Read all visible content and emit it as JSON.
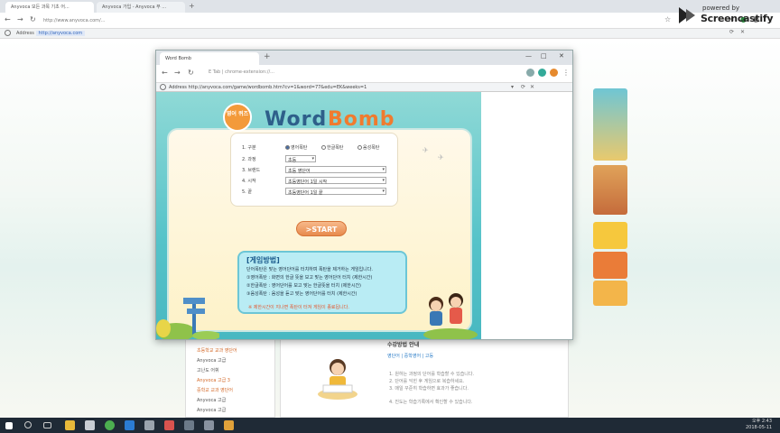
{
  "outer_browser": {
    "tabs": [
      {
        "label": "Anyvoca 모든 과목 기초 어..."
      },
      {
        "label": "Anyvoca 가입 - Anyvoca 무 ..."
      }
    ],
    "url": "http://www.anyvoca.com/...",
    "address_label": "Address",
    "address_url": "http://anyvoca.com"
  },
  "screencastify": {
    "powered": "powered by",
    "name": "Screencastify"
  },
  "popup": {
    "tab_title": "Word Bomb",
    "url": "E Tab | chrome-extension://...",
    "address_label": "Address",
    "address_url": "http://anyvoca.com/game/wordbomb.htm?cv=1&word=77&edu=EK&weeks=1"
  },
  "game": {
    "badge": "영어 퀴즈",
    "title_word": "Word",
    "title_bomb": "Bomb",
    "form": {
      "row1_label": "1. 구분",
      "row1_options": [
        {
          "label": "영어폭탄",
          "checked": true
        },
        {
          "label": "한글폭탄",
          "checked": false
        },
        {
          "label": "음성폭탄",
          "checked": false
        }
      ],
      "row2_label": "2. 과정",
      "row2_value": "초등",
      "row3_label": "3. 브랜드",
      "row3_value": "초등 영단어",
      "row4_label": "4. 시작",
      "row4_value": "초등영단어 1일 시작",
      "row5_label": "5. 끝",
      "row5_value": "초등영단어 1일 끝"
    },
    "start_label": ">START",
    "howto": {
      "title": "[게임방법]",
      "lines": [
        "단어폭탄은 맞는 영어단어를 터치하며 폭탄을 제거하는 게임입니다.",
        "①영어폭탄 : 화면의 한글 뜻을 보고 맞는 영어단어 터치 (제한시간)",
        "②한글폭탄 : 영어단어를 보고 맞는 한글뜻을 터치 (제한시간)",
        "③음성폭탄 : 음성을 듣고 맞는 영어단어를 터치 (제한시간)"
      ],
      "warning": "※ 제한시간이 지나면 폭탄이 터져 게임이 종료됩니다."
    }
  },
  "background_page": {
    "sidebar_links": [
      {
        "label": "초등학교 교과 영단어",
        "orange": true
      },
      {
        "label": "Anyvoca 고급",
        "orange": false
      },
      {
        "label": "고난도 어휘",
        "orange": false
      },
      {
        "label": "Anyvoca 고급 3",
        "orange": true
      },
      {
        "label": "중학교 교과 영단어",
        "orange": true
      },
      {
        "label": "Anyvoca 고급",
        "orange": false
      },
      {
        "label": "Anyvoca 고급",
        "orange": false
      }
    ],
    "notice_title": "수강방법 안내",
    "notice_tabs": "영단어 | 중학영어 | 고등",
    "notice_lines": [
      "1. 원하는 과정의 단어를 학습할 수 있습니다.",
      "2. 단어를 익힌 후 게임으로 복습하세요.",
      "3. 매일 꾸준히 학습하면 효과가 좋습니다.",
      "4. 진도는 학습기록에서 확인할 수 있습니다."
    ]
  },
  "taskbar": {
    "time": "오후 2:43",
    "date": "2018-05-11"
  }
}
